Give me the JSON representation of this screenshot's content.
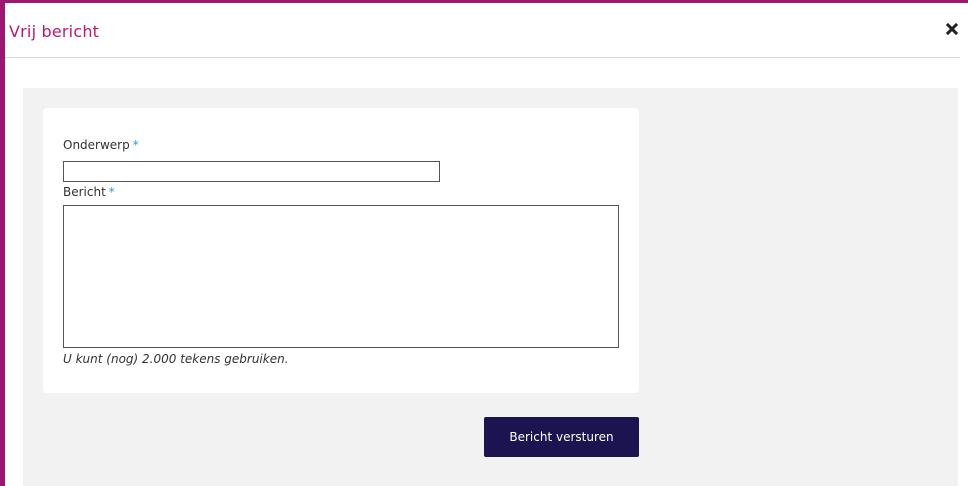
{
  "dialog": {
    "title": "Vrij bericht",
    "close_icon": "close-icon"
  },
  "form": {
    "subject_label": "Onderwerp",
    "subject_value": "",
    "message_label": "Bericht",
    "message_value": "",
    "required_marker": "*",
    "char_counter": "U kunt (nog) 2.000 tekens gebruiken.",
    "submit_label": "Bericht versturen"
  },
  "colors": {
    "accent_border": "#9c1870",
    "title": "#c4156e",
    "required_star": "#2b9ad8",
    "button_bg": "#1b1450",
    "body_bg": "#f2f2f2"
  }
}
